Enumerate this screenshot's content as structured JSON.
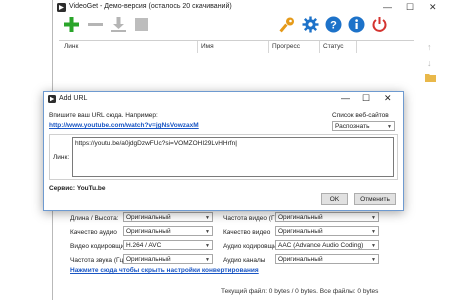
{
  "main": {
    "title": "VideoGet - Демо-версия (осталось 20 скачиваний)",
    "columns": [
      "Линк",
      "Имя",
      "Прогресс",
      "Статус"
    ]
  },
  "settings": {
    "rows": [
      {
        "label": "Длина / Высота:",
        "value": "Оригинальный"
      },
      {
        "label": "Качество аудио",
        "value": "Оригинальный"
      },
      {
        "label": "Видео кодировщик",
        "value": "H.264 / AVC"
      },
      {
        "label": "Частота звука (Гц)",
        "value": "Оригинальный"
      }
    ],
    "rows_right": [
      {
        "label": "Частота видео (Гц)",
        "value": "Оригинальный"
      },
      {
        "label": "Качество видео",
        "value": "Оригинальный"
      },
      {
        "label": "Аудио кодировщик",
        "value": "AAC (Advance Audio Coding)"
      },
      {
        "label": "Аудио каналы",
        "value": "Оригинальный"
      }
    ],
    "hide_link": "Нажмите сюда чтобы скрыть настройки конвертирования"
  },
  "statusbar": {
    "text": "Текущий файл: 0 bytes / 0 bytes. Все файлы: 0 bytes"
  },
  "dialog": {
    "title": "Add URL",
    "instruction": "Впишите ваш URL сюда. Например:",
    "example_url": "http://www.youtube.com/watch?v=jgNsVowzaxM",
    "sites_label": "Список веб-сайтов",
    "sites_value": "Распознать",
    "link_label": "Линк:",
    "link_value": "https://youtu.be/a0jdgDzwFUc?si=VOMZOHI29LvHHrfn",
    "service_label": "Сервис: YouTu.be",
    "ok_label": "OK",
    "cancel_label": "Отменить"
  },
  "colors": {
    "add_green": "#2aa52a",
    "link_blue": "#1a56c4",
    "info_blue": "#1d72c9",
    "power_red": "#d4332f",
    "gear_blue": "#1d72c9",
    "key_orange": "#e59a19",
    "dialog_border": "#6e9ad0"
  }
}
